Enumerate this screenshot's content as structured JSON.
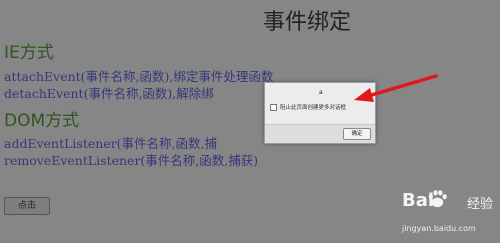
{
  "page": {
    "title": "事件绑定",
    "ie_heading": "IE方式",
    "ie_lines": [
      "attachEvent(事件名称,函数),绑定事件处理函数",
      "detachEvent(事件名称,函数),解除绑"
    ],
    "dom_heading": "DOM方式",
    "dom_lines": [
      "addEventListener(事件名称,函数,捕",
      "removeEventListener(事件名称,函数,捕获)"
    ],
    "click_button": "点击"
  },
  "dialog": {
    "message": "a",
    "checkbox_label": "阻止此页面创建更多对话框",
    "ok_label": "确定"
  },
  "watermark": {
    "brand_b": "Bai",
    "brand_tail": "经验",
    "url": "jingyan.baidu.com"
  },
  "colors": {
    "background": "#868686",
    "heading_green": "#2f5520",
    "code_blue": "#35377a",
    "arrow_red": "#e0191d"
  }
}
